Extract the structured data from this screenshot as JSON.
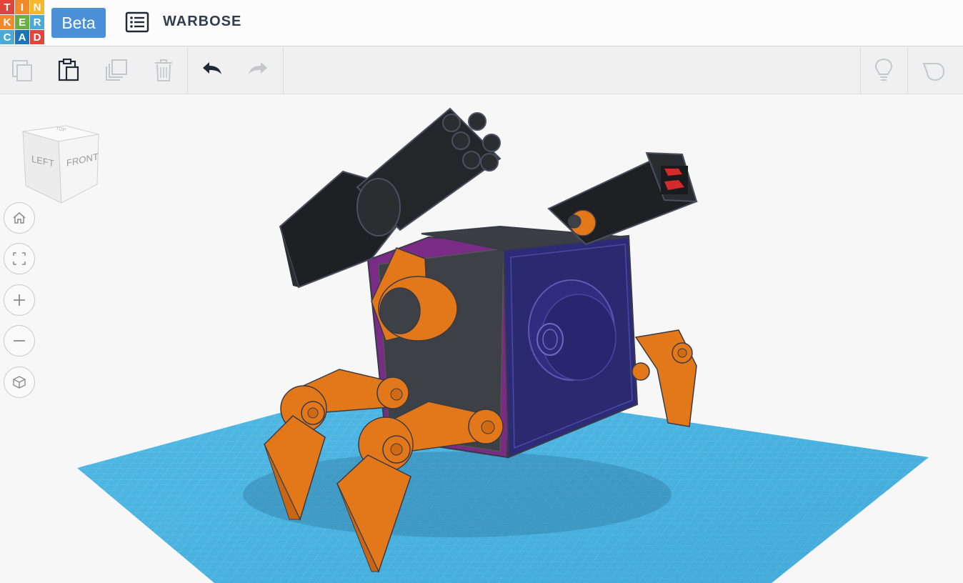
{
  "logo": {
    "letters": [
      "T",
      "I",
      "N",
      "K",
      "E",
      "R",
      "C",
      "A",
      "D"
    ],
    "colors": [
      "#e0443b",
      "#f08a2c",
      "#f5b82c",
      "#f08a2c",
      "#6cb043",
      "#4ca9d6",
      "#4ca9d6",
      "#1d74b8",
      "#e0443b"
    ]
  },
  "header": {
    "beta_label": "Beta",
    "design_title": "WARBOSE"
  },
  "toolbar": {
    "icons": [
      "copy-icon",
      "paste-icon",
      "duplicate-icon",
      "delete-icon",
      "undo-icon",
      "redo-icon",
      "hint-lightbulb-icon",
      "notes-icon"
    ]
  },
  "viewcube": {
    "left_label": "LEFT",
    "front_label": "FRONT",
    "top_label": "TOP"
  },
  "nav": {
    "icons": [
      "home-icon",
      "fit-view-icon",
      "zoom-in-icon",
      "zoom-out-icon",
      "perspective-icon"
    ]
  },
  "colors": {
    "accent": "#4a90d9",
    "grid": "#4fb7e3",
    "orange": "#e3781b",
    "dark": "#2b2d30",
    "blue_body": "#2c2b78",
    "purple_edge": "#7a2b86"
  }
}
